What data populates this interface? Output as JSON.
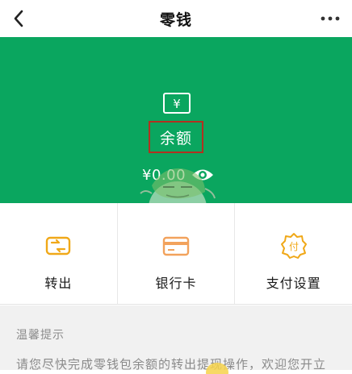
{
  "header": {
    "title": "零钱",
    "back_icon": "chevron-left-icon",
    "more_icon": "more-dots-icon"
  },
  "balance": {
    "icon": "wallet-yen-icon",
    "icon_glyph": "¥",
    "label": "余额",
    "amount": "¥0.00",
    "visibility_icon": "eye-icon",
    "background": "#0aa65f",
    "highlight_border": "#b2311f"
  },
  "actions": [
    {
      "label": "转出",
      "icon": "transfer-out-icon",
      "color": "#f0a818"
    },
    {
      "label": "银行卡",
      "icon": "bank-card-icon",
      "color": "#f2a25c"
    },
    {
      "label": "支付设置",
      "icon": "payment-settings-icon",
      "icon_glyph": "付",
      "color": "#f0a818"
    }
  ],
  "notice": {
    "title": "温馨提示",
    "text": "请您尽快完成零钱包余额的转出提现操作，欢迎您开立"
  }
}
